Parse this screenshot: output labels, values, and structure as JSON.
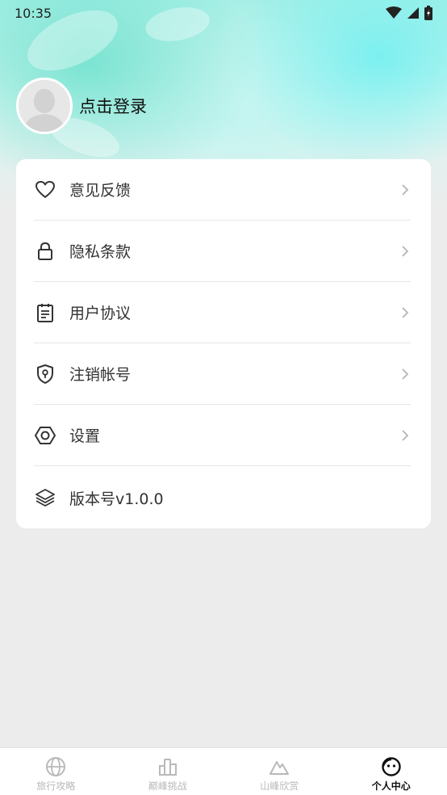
{
  "status_bar": {
    "time": "10:35"
  },
  "profile": {
    "login_label": "点击登录"
  },
  "menu": [
    {
      "label": "意见反馈",
      "icon": "heart-icon",
      "chevron": true
    },
    {
      "label": "隐私条款",
      "icon": "lock-icon",
      "chevron": true
    },
    {
      "label": "用户协议",
      "icon": "clipboard-icon",
      "chevron": true
    },
    {
      "label": "注销帐号",
      "icon": "shield-key-icon",
      "chevron": true
    },
    {
      "label": "设置",
      "icon": "hexagon-settings-icon",
      "chevron": true
    },
    {
      "label": "版本号v1.0.0",
      "icon": "layers-icon",
      "chevron": false
    }
  ],
  "tabbar": [
    {
      "label": "旅行攻略",
      "icon": "globe-icon",
      "active": false
    },
    {
      "label": "巅峰挑战",
      "icon": "bar-chart-icon",
      "active": false
    },
    {
      "label": "山峰欣赏",
      "icon": "mountain-icon",
      "active": false
    },
    {
      "label": "个人中心",
      "icon": "smile-face-icon",
      "active": true
    }
  ],
  "colors": {
    "background": "#ececec",
    "card": "#ffffff",
    "active_tab": "#111111",
    "inactive_tab": "#b9b9b9"
  }
}
